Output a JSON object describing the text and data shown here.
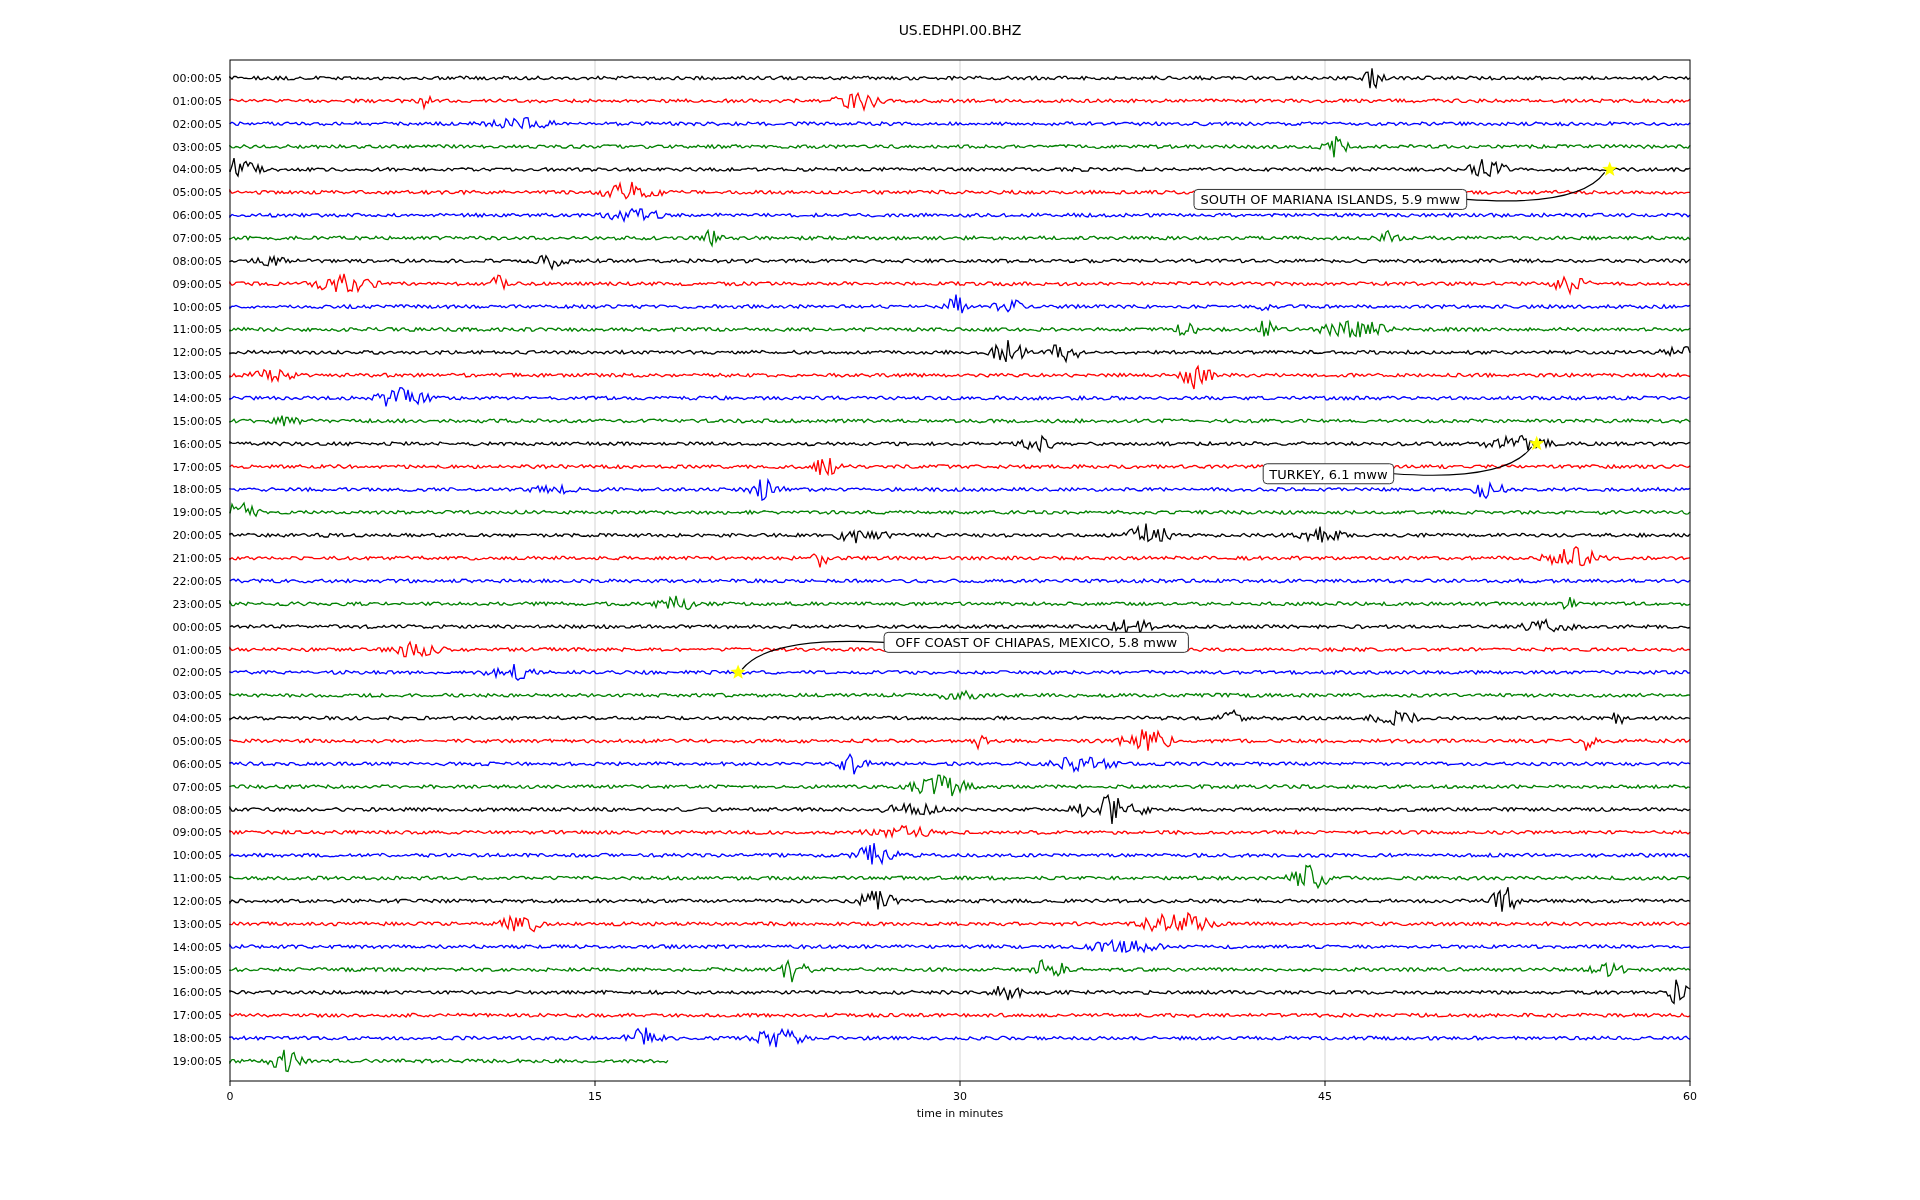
{
  "title": "US.EDHPI.00.BHZ",
  "rows": [
    {
      "label": "00:00:05",
      "color": "#000000",
      "complete": true
    },
    {
      "label": "01:00:05",
      "color": "#ff0000",
      "complete": true
    },
    {
      "label": "02:00:05",
      "color": "#0000ff",
      "complete": true
    },
    {
      "label": "03:00:05",
      "color": "#008000",
      "complete": true
    },
    {
      "label": "04:00:05",
      "color": "#000000",
      "complete": true,
      "event": {
        "label": "SOUTH OF MARIANA ISLANDS, 5.9 mww",
        "level": 0.945,
        "kind": "below"
      }
    },
    {
      "label": "05:00:05",
      "color": "#ff0000",
      "complete": true
    },
    {
      "label": "06:00:05",
      "color": "#0000ff",
      "complete": true
    },
    {
      "label": "07:00:05",
      "color": "#008000",
      "complete": true
    },
    {
      "label": "08:00:05",
      "color": "#000000",
      "complete": true
    },
    {
      "label": "09:00:05",
      "color": "#ff0000",
      "complete": true
    },
    {
      "label": "10:00:05",
      "color": "#0000ff",
      "complete": true
    },
    {
      "label": "11:00:05",
      "color": "#008000",
      "complete": true
    },
    {
      "label": "12:00:05",
      "color": "#000000",
      "complete": true
    },
    {
      "label": "13:00:05",
      "color": "#ff0000",
      "complete": true
    },
    {
      "label": "14:00:05",
      "color": "#0000ff",
      "complete": true
    },
    {
      "label": "15:00:05",
      "color": "#008000",
      "complete": true
    },
    {
      "label": "16:00:05",
      "color": "#000000",
      "complete": true,
      "event": {
        "label": "TURKEY, 6.1 mww",
        "level": 0.895,
        "kind": "below"
      }
    },
    {
      "label": "17:00:05",
      "color": "#ff0000",
      "complete": true
    },
    {
      "label": "18:00:05",
      "color": "#0000ff",
      "complete": true
    },
    {
      "label": "19:00:05",
      "color": "#008000",
      "complete": true
    },
    {
      "label": "20:00:05",
      "color": "#000000",
      "complete": true
    },
    {
      "label": "21:00:05",
      "color": "#ff0000",
      "complete": true
    },
    {
      "label": "22:00:05",
      "color": "#0000ff",
      "complete": true
    },
    {
      "label": "23:00:05",
      "color": "#008000",
      "complete": true
    },
    {
      "label": "00:00:05",
      "color": "#000000",
      "complete": true
    },
    {
      "label": "01:00:05",
      "color": "#ff0000",
      "complete": true
    },
    {
      "label": "02:00:05",
      "color": "#0000ff",
      "complete": true,
      "event": {
        "label": "OFF COAST OF CHIAPAS, MEXICO, 5.8 mww",
        "level": 0.348,
        "kind": "above"
      }
    },
    {
      "label": "03:00:05",
      "color": "#008000",
      "complete": true
    },
    {
      "label": "04:00:05",
      "color": "#000000",
      "complete": true
    },
    {
      "label": "05:00:05",
      "color": "#ff0000",
      "complete": true
    },
    {
      "label": "06:00:05",
      "color": "#0000ff",
      "complete": true
    },
    {
      "label": "07:00:05",
      "color": "#008000",
      "complete": true
    },
    {
      "label": "08:00:05",
      "color": "#000000",
      "complete": true
    },
    {
      "label": "09:00:05",
      "color": "#ff0000",
      "complete": true
    },
    {
      "label": "10:00:05",
      "color": "#0000ff",
      "complete": true
    },
    {
      "label": "11:00:05",
      "color": "#008000",
      "complete": true
    },
    {
      "label": "12:00:05",
      "color": "#000000",
      "complete": true
    },
    {
      "label": "13:00:05",
      "color": "#ff0000",
      "complete": true
    },
    {
      "label": "14:00:05",
      "color": "#0000ff",
      "complete": true
    },
    {
      "label": "15:00:05",
      "color": "#008000",
      "complete": true
    },
    {
      "label": "16:00:05",
      "color": "#000000",
      "complete": true
    },
    {
      "label": "17:00:05",
      "color": "#ff0000",
      "complete": true
    },
    {
      "label": "18:00:05",
      "color": "#0000ff",
      "complete": true
    },
    {
      "label": "19:00:05",
      "color": "#008000",
      "complete": false
    }
  ],
  "x_ticks": [
    "0",
    "15",
    "30",
    "45",
    "60"
  ],
  "xlabel": "time in minutes"
}
